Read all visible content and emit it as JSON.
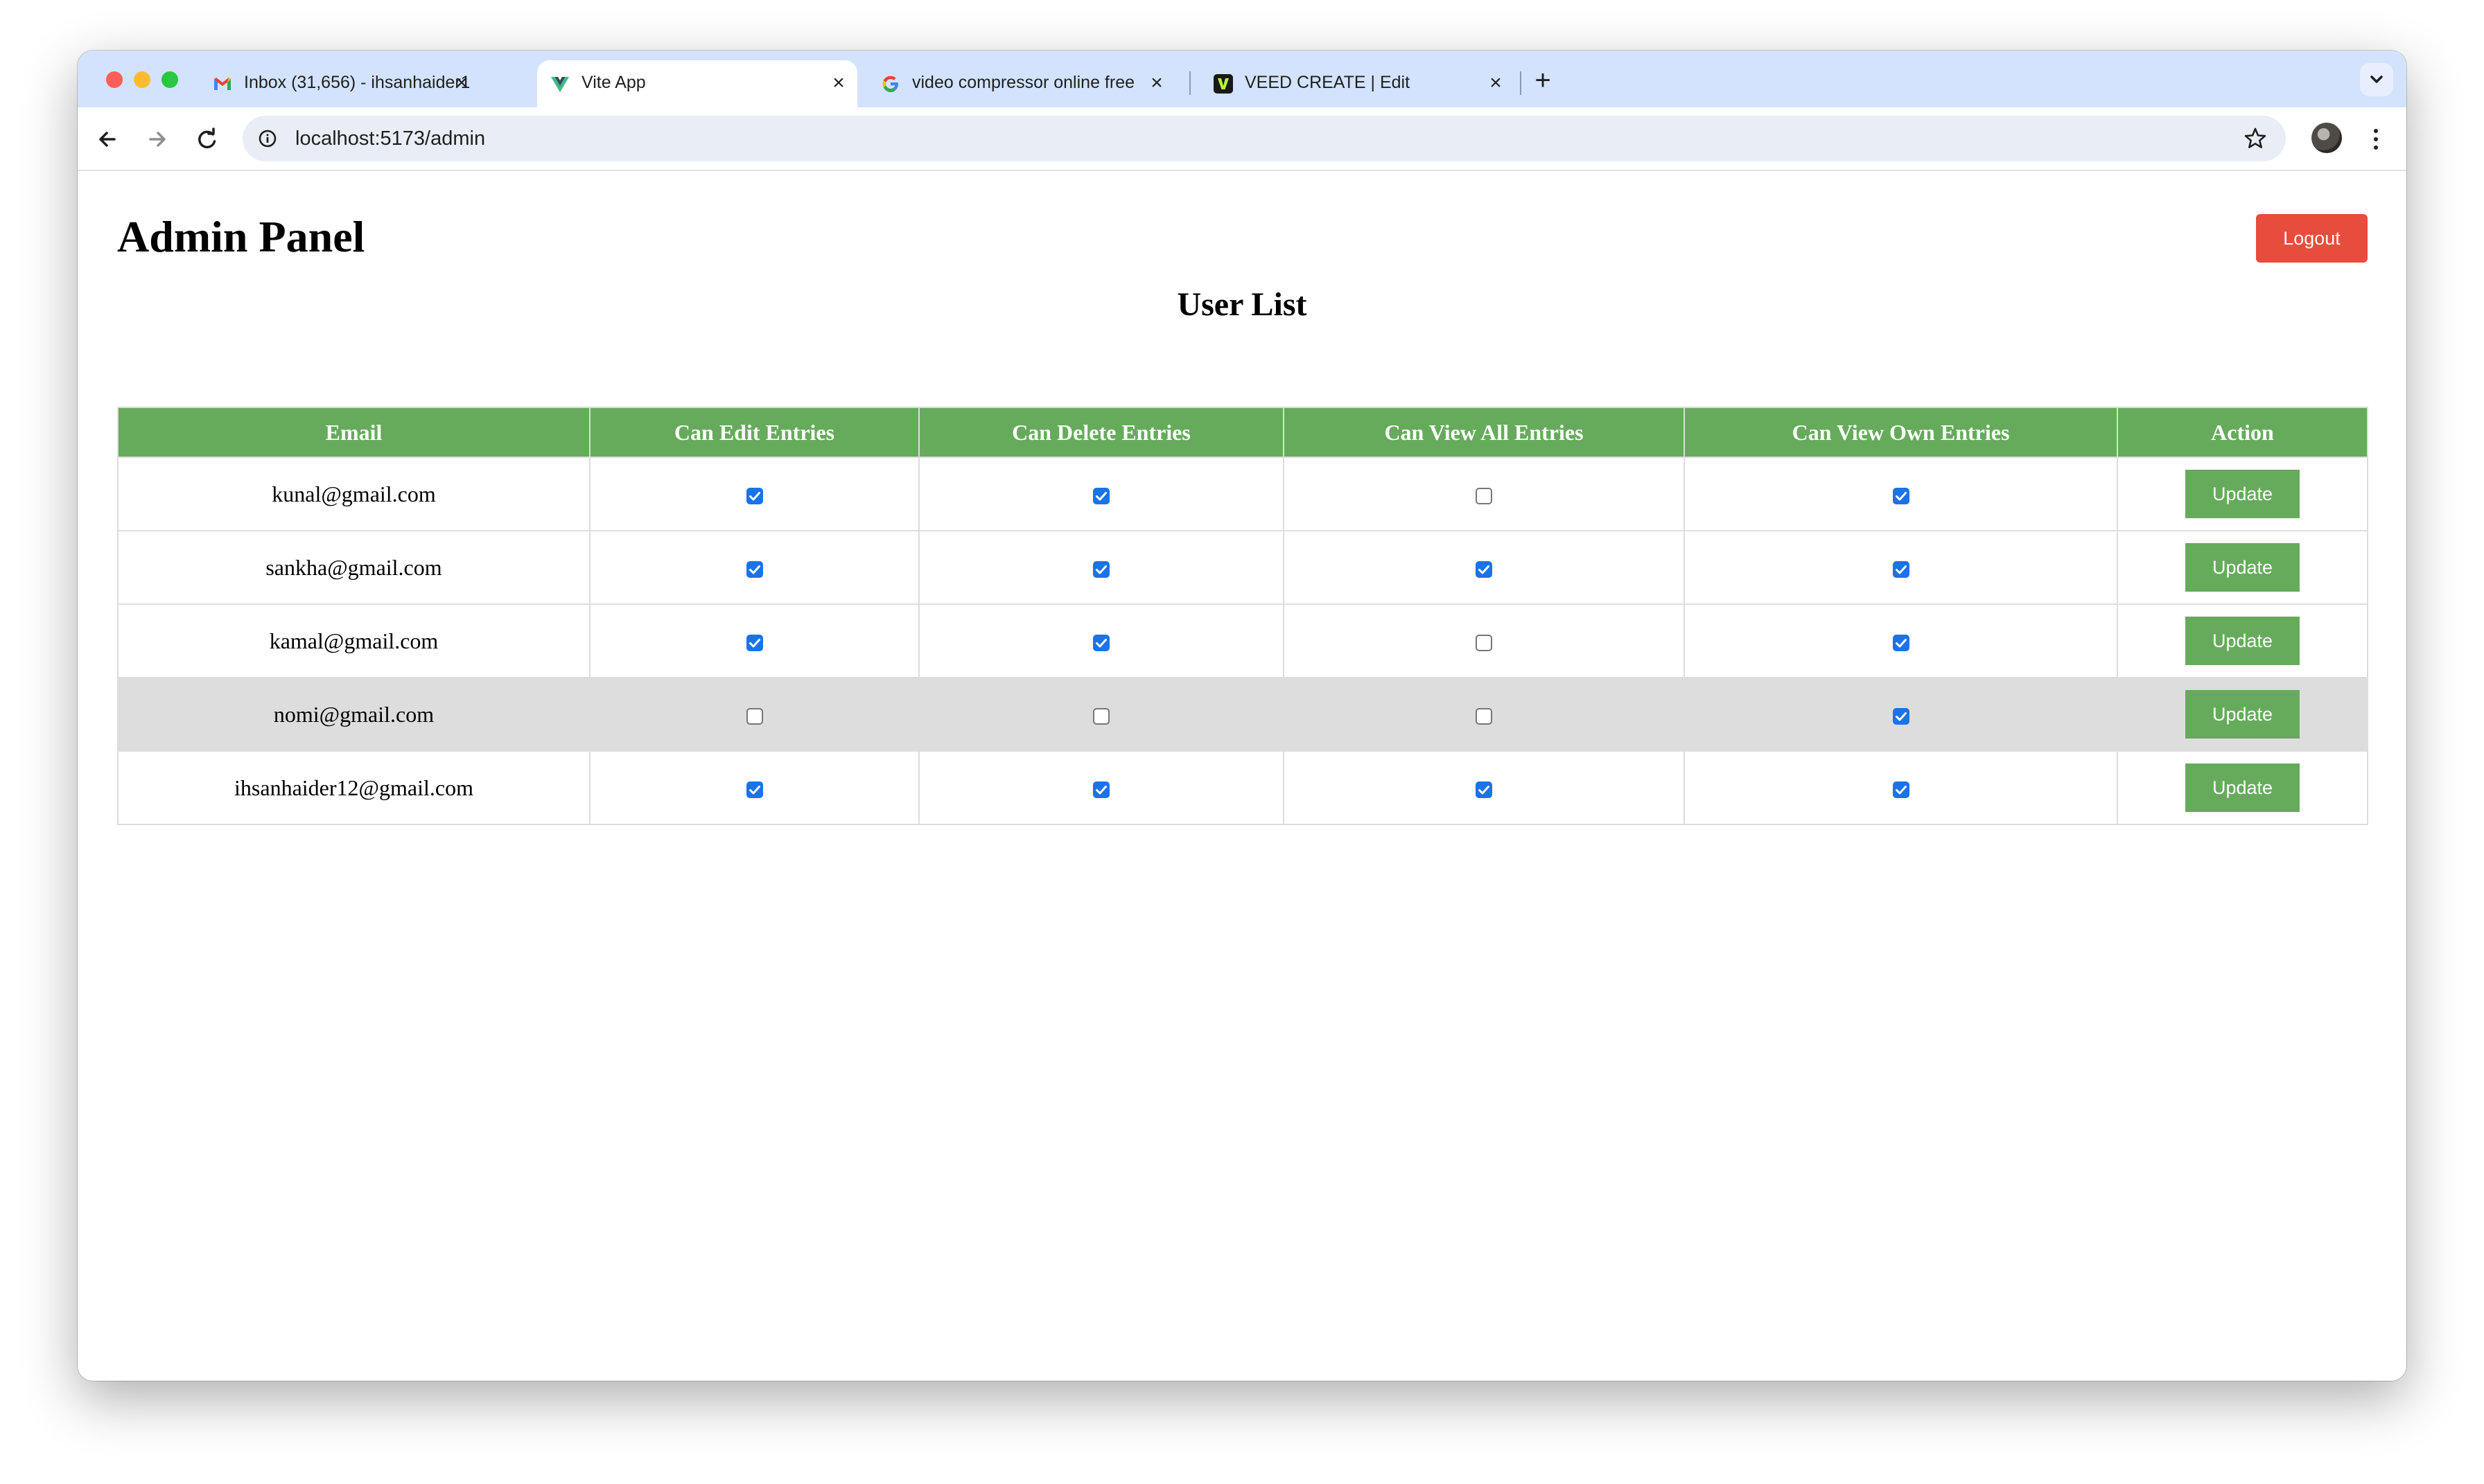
{
  "browser": {
    "tabs": [
      {
        "title": "Inbox (31,656) - ihsanhaider1",
        "icon": "gmail-icon",
        "active": false
      },
      {
        "title": "Vite App",
        "icon": "vue-icon",
        "active": true
      },
      {
        "title": "video compressor online free",
        "icon": "google-icon",
        "active": false
      },
      {
        "title": "VEED CREATE | Edit",
        "icon": "veed-icon",
        "active": false
      }
    ],
    "address_bar": {
      "url": "localhost:5173/admin"
    }
  },
  "page": {
    "title": "Admin Panel",
    "logout_label": "Logout",
    "section_title": "User List",
    "table": {
      "columns": [
        "Email",
        "Can Edit Entries",
        "Can Delete Entries",
        "Can View All Entries",
        "Can View Own Entries",
        "Action"
      ],
      "rows": [
        {
          "email": "kunal@gmail.com",
          "can_edit": true,
          "can_delete": true,
          "can_view_all": false,
          "can_view_own": true,
          "action": "Update"
        },
        {
          "email": "sankha@gmail.com",
          "can_edit": true,
          "can_delete": true,
          "can_view_all": true,
          "can_view_own": true,
          "action": "Update"
        },
        {
          "email": "kamal@gmail.com",
          "can_edit": true,
          "can_delete": true,
          "can_view_all": false,
          "can_view_own": true,
          "action": "Update"
        },
        {
          "email": "nomi@gmail.com",
          "can_edit": false,
          "can_delete": false,
          "can_view_all": false,
          "can_view_own": true,
          "action": "Update"
        },
        {
          "email": "ihsanhaider12@gmail.com",
          "can_edit": true,
          "can_delete": true,
          "can_view_all": true,
          "can_view_own": true,
          "action": "Update"
        }
      ]
    }
  },
  "colors": {
    "table_header": "#66ab5c",
    "update_button": "#66ab5c",
    "logout_button": "#e74c3c",
    "checkbox_checked": "#1a73e8",
    "hover_row": "#dddddd",
    "tab_strip": "#d3e3fd"
  }
}
